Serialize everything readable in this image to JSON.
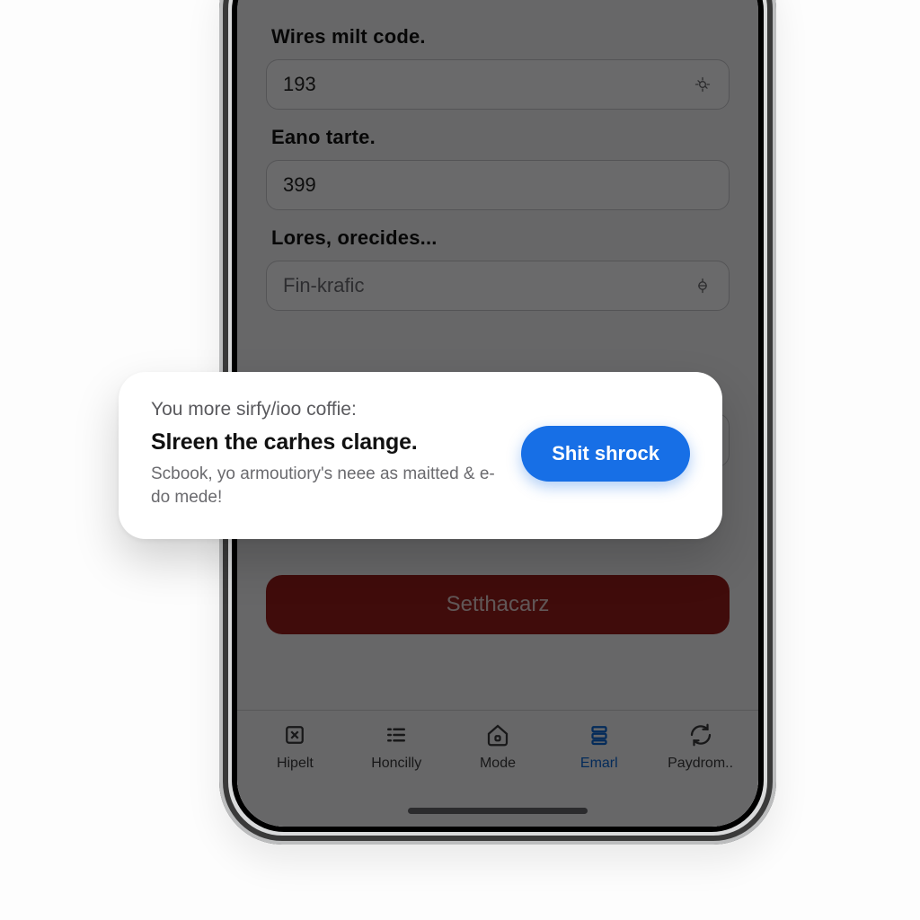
{
  "form": {
    "field1": {
      "label": "Wires milt code.",
      "value": "193"
    },
    "field2": {
      "label": "Eano tarte.",
      "value": "399"
    },
    "field3": {
      "label": "Lores, orecides...",
      "value": "Fin-krafic"
    }
  },
  "primary_button": {
    "label": "Setthacarz"
  },
  "popup": {
    "eyebrow": "You more sirfy/ioo coffie:",
    "title": "Slreen the carhes clange.",
    "body": "Scbook, yo armoutiory's neee as maitted & e-do mede!",
    "action_label": "Shit shrock"
  },
  "tabs": [
    {
      "label": "Hipelt"
    },
    {
      "label": "Honcilly"
    },
    {
      "label": "Mode"
    },
    {
      "label": "Emarl"
    },
    {
      "label": "Paydrom.."
    }
  ],
  "colors": {
    "accent_blue": "#176fe6",
    "danger_red": "#9a1e1b"
  }
}
